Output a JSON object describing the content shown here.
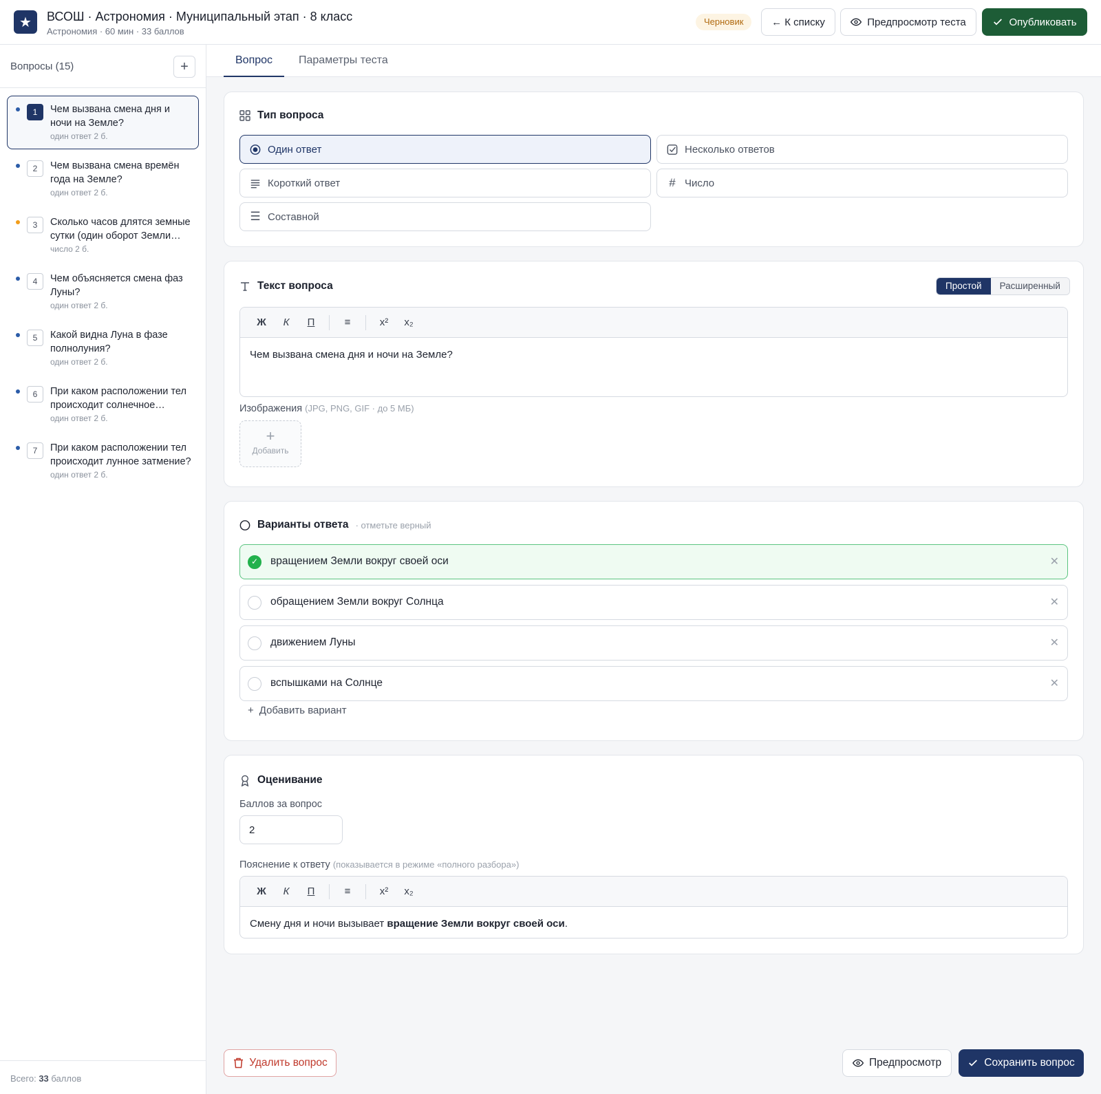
{
  "header": {
    "title": "ВСОШ · Астрономия · Муниципальный этап · 8 класс",
    "subtitle": "Астрономия · 60 мин · 33 баллов",
    "status_badge": "Черновик",
    "back_label": "← К списку",
    "preview_label": "Предпросмотр теста",
    "publish_label": "Опубликовать"
  },
  "sidebar": {
    "title": "Вопросы (15)",
    "add_label": "+",
    "items": [
      {
        "num": "1",
        "text": "Чем вызвана смена дня и ночи на Земле?",
        "meta": "один ответ  2 б."
      },
      {
        "num": "2",
        "text": "Чем вызвана смена времён года на Земле?",
        "meta": "один ответ  2 б."
      },
      {
        "num": "3",
        "text": "Сколько часов длятся земные сутки (один оборот Земли вокруг своей оси)?",
        "meta": "число  2 б."
      },
      {
        "num": "4",
        "text": "Чем объясняется смена фаз Луны?",
        "meta": "один ответ  2 б."
      },
      {
        "num": "5",
        "text": "Какой видна Луна в фазе полнолуния?",
        "meta": "один ответ  2 б."
      },
      {
        "num": "6",
        "text": "При каком расположении тел происходит солнечное затмение?",
        "meta": "один ответ  2 б."
      },
      {
        "num": "7",
        "text": "При каком расположении тел происходит лунное затмение?",
        "meta": "один ответ  2 б."
      }
    ],
    "total_prefix": "Всего: ",
    "total_value": "33",
    "total_suffix": " баллов"
  },
  "tabs": {
    "question": "Вопрос",
    "params": "Параметры теста"
  },
  "type_card": {
    "title": "Тип вопроса",
    "types": {
      "single": "Один ответ",
      "multiple": "Несколько ответов",
      "short": "Короткий ответ",
      "number": "Число",
      "composite": "Составной"
    }
  },
  "text_card": {
    "title": "Текст вопроса",
    "mode_simple": "Простой",
    "mode_extended": "Расширенный",
    "toolbar": {
      "bold": "Ж",
      "italic": "К",
      "underline": "П",
      "list": "≡",
      "sup": "x²",
      "sub": "x₂"
    },
    "question_text": "Чем вызвана смена дня и ночи на Земле?",
    "images_label": "Изображения",
    "images_hint": "(JPG, PNG, GIF · до 5 МБ)",
    "add_image": "Добавить"
  },
  "answers_card": {
    "title": "Варианты ответа",
    "hint": "· отметьте верный",
    "options": [
      {
        "text": "вращением Земли вокруг своей оси",
        "correct": true
      },
      {
        "text": "обращением Земли вокруг Солнца",
        "correct": false
      },
      {
        "text": "движением Луны",
        "correct": false
      },
      {
        "text": "вспышками на Солнце",
        "correct": false
      }
    ],
    "add_option": "Добавить вариант"
  },
  "grading_card": {
    "title": "Оценивание",
    "score_label": "Баллов за вопрос",
    "score_value": "2",
    "explanation_label": "Пояснение к ответу",
    "explanation_hint": "(показывается в режиме «полного разбора»)",
    "explanation_before": "Смену дня и ночи вызывает ",
    "explanation_bold": "вращение Земли вокруг своей оси",
    "explanation_after": "."
  },
  "footer": {
    "delete_label": "Удалить вопрос",
    "preview_label": "Предпросмотр",
    "save_label": "Сохранить вопрос"
  },
  "colors": {
    "brand": "#1f3566",
    "publish": "#1d5c36",
    "correct": "#22b14c",
    "danger": "#c0392b",
    "draft_badge": "#b06a10"
  }
}
